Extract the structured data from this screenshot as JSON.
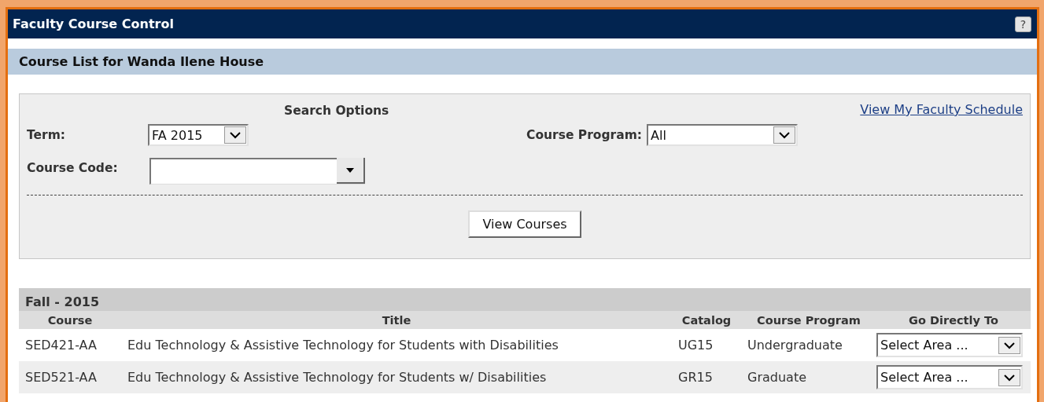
{
  "window": {
    "title": "Faculty Course Control",
    "help_button": "?"
  },
  "subheader": "Course List for Wanda Ilene House",
  "search": {
    "heading": "Search Options",
    "link": "View My Faculty Schedule",
    "fields": [
      {
        "label": "Term:",
        "value": "FA 2015",
        "kind": "select"
      },
      {
        "label": "Course Program:",
        "value": "All",
        "kind": "select"
      },
      {
        "label": "Course Code:",
        "kind": "combo"
      }
    ],
    "button": "View Courses"
  },
  "section": {
    "heading": "Fall - 2015",
    "columns": [
      "Course",
      "Title",
      "Catalog",
      "Course Program",
      "Go Directly To"
    ],
    "rows": [
      {
        "course": "SED421-AA",
        "title": "Edu Technology & Assistive Technology for Students with Disabilities",
        "catalog": "UG15",
        "program": "Undergraduate",
        "go_to": "Select Area ..."
      },
      {
        "course": "SED521-AA",
        "title": "Edu Technology & Assistive Technology for Students w/ Disabilities",
        "catalog": "GR15",
        "program": "Graduate",
        "go_to": "Select Area ..."
      }
    ]
  }
}
